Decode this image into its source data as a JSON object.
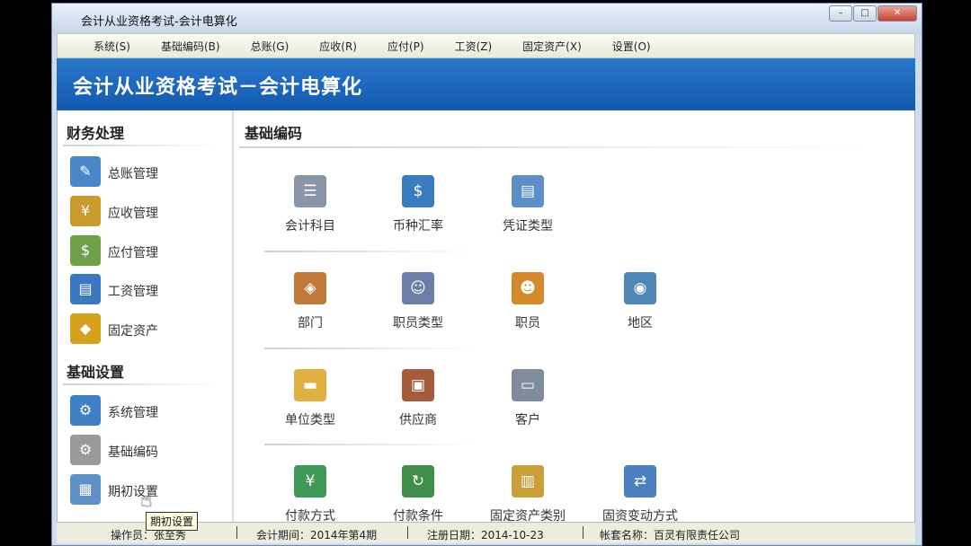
{
  "window": {
    "title": "会计从业资格考试-会计电算化",
    "controls": [
      "–",
      "□",
      "✕"
    ]
  },
  "menu": [
    "系统(S)",
    "基础编码(B)",
    "总账(G)",
    "应收(R)",
    "应付(P)",
    "工资(Z)",
    "固定资产(X)",
    "设置(O)"
  ],
  "banner": {
    "title": "会计从业资格考试－会计电算化"
  },
  "sidebar": {
    "finance_title": "财务处理",
    "finance_items": [
      {
        "label": "总账管理",
        "icon": "ledger-book-icon"
      },
      {
        "label": "应收管理",
        "icon": "receivable-money-icon"
      },
      {
        "label": "应付管理",
        "icon": "payable-money-icon"
      },
      {
        "label": "工资管理",
        "icon": "payroll-icon"
      },
      {
        "label": "固定资产",
        "icon": "fixed-asset-bag-icon"
      }
    ],
    "basic_title": "基础设置",
    "basic_items": [
      {
        "label": "系统管理",
        "icon": "system-gears-icon"
      },
      {
        "label": "基础编码",
        "icon": "basic-gear-icon"
      },
      {
        "label": "期初设置",
        "icon": "calendar-grid-icon"
      }
    ]
  },
  "main": {
    "title": "基础编码",
    "items": [
      {
        "label": "会计科目",
        "icon": "account-tree-icon",
        "color": "#8a96a8"
      },
      {
        "label": "币种汇率",
        "icon": "currency-rate-icon",
        "color": "#3a7cc0"
      },
      {
        "label": "凭证类型",
        "icon": "voucher-type-icon",
        "color": "#5d8ec8"
      },
      {
        "label": "部门",
        "icon": "department-icon",
        "color": "#c07a3a"
      },
      {
        "label": "职员类型",
        "icon": "staff-type-icon",
        "color": "#6a7fa8"
      },
      {
        "label": "职员",
        "icon": "employee-icon",
        "color": "#d28a2a"
      },
      {
        "label": "地区",
        "icon": "region-globe-icon",
        "color": "#4f86b5"
      },
      {
        "label": "单位类型",
        "icon": "unit-type-icon",
        "color": "#e0b040"
      },
      {
        "label": "供应商",
        "icon": "supplier-icon",
        "color": "#a45c3c"
      },
      {
        "label": "客户",
        "icon": "customer-card-icon",
        "color": "#7f8c9c"
      },
      {
        "label": "付款方式",
        "icon": "payment-method-icon",
        "color": "#3f9a5a"
      },
      {
        "label": "付款条件",
        "icon": "payment-terms-icon",
        "color": "#3f8f4a"
      },
      {
        "label": "固定资产类别",
        "icon": "asset-category-icon",
        "color": "#c8a03a"
      },
      {
        "label": "固资变动方式",
        "icon": "asset-change-icon",
        "color": "#4a7fc0"
      }
    ]
  },
  "status": {
    "operator": "操作员：张至秀",
    "period": "会计期间：2014年第4期",
    "reg_date": "注册日期：2014-10-23",
    "company": "帐套名称：百灵有限责任公司"
  },
  "tooltip": "期初设置",
  "colors": {
    "banner": "#1a66be",
    "ledger": "#4a86c8",
    "receivable": "#c99a2e",
    "payable": "#6fa04a",
    "payroll": "#3b78c2",
    "asset": "#d6a21e",
    "system": "#3f7fc4",
    "basic": "#9a9a9a",
    "calendar": "#5f90c8"
  }
}
